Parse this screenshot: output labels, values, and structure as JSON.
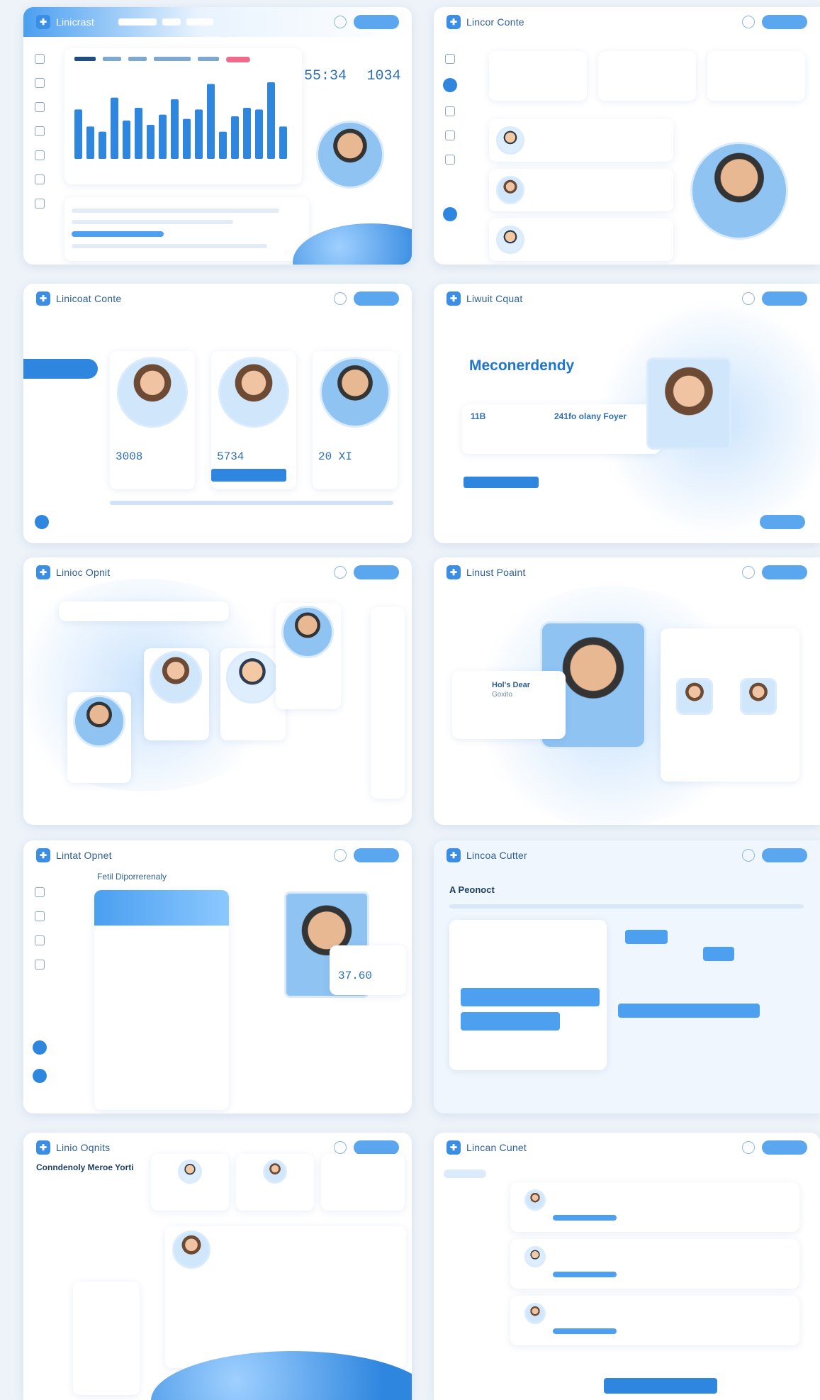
{
  "cards": {
    "c1": {
      "title": "Linicrast",
      "stat1": "55:34",
      "stat2": "1034"
    },
    "c2": {
      "title": "Lincor Conte"
    },
    "c3": {
      "title": "Linicoat Conte",
      "values": [
        "3008",
        "5734",
        "20 XI"
      ]
    },
    "c4": {
      "title": "Liwuit Cquat",
      "headline": "Meconerdendy",
      "label1": "11B",
      "label2": "241fo olany Foyer"
    },
    "c5": {
      "title": "Linioc Opnit"
    },
    "c6": {
      "title": "Linust Poaint",
      "caption1": "Hol's Dear",
      "caption2": "Goxito"
    },
    "c7": {
      "title": "Lintat Opnet",
      "subtitle": "Fetil Diporrerenaly",
      "value": "37.60"
    },
    "c8": {
      "title": "Lincoa Cutter",
      "subtitle": "A Peonoct"
    },
    "c9": {
      "title": "Linio Oqnits",
      "subtitle": "Conndenoly Meroe Yorti"
    },
    "c10": {
      "title": "Lincan Cunet"
    }
  },
  "c1_bars": [
    58,
    38,
    32,
    72,
    45,
    60,
    40,
    52,
    70,
    47,
    58,
    88,
    32,
    50,
    60,
    58,
    90,
    38
  ],
  "colors": {
    "accent": "#2f86df",
    "light": "#e8f3fe",
    "text": "#2f5f92"
  },
  "icons": [
    "logo-icon",
    "search-icon",
    "gear-icon",
    "bell-icon",
    "chart-icon",
    "user-icon",
    "heart-icon",
    "calendar-icon",
    "file-icon"
  ]
}
